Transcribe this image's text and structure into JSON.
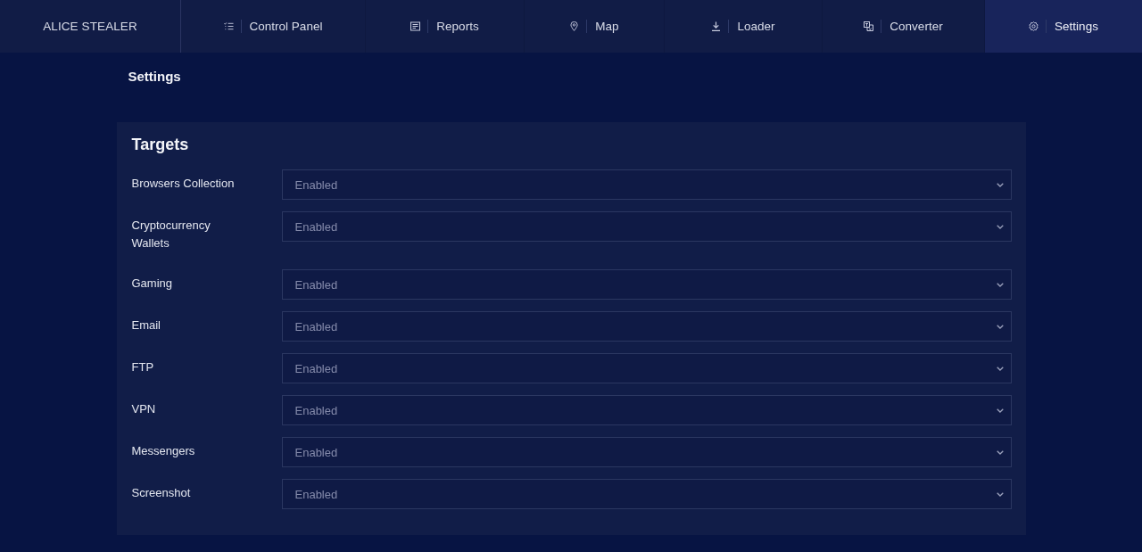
{
  "nav": {
    "brand": "ALICE STEALER",
    "tabs": [
      {
        "label": "Control Panel",
        "selected": false
      },
      {
        "label": "Reports",
        "selected": false
      },
      {
        "label": "Map",
        "selected": false
      },
      {
        "label": "Loader",
        "selected": false
      },
      {
        "label": "Converter",
        "selected": false
      },
      {
        "label": "Settings",
        "selected": true
      }
    ]
  },
  "page": {
    "title": "Settings"
  },
  "section": {
    "title": "Targets",
    "fields": [
      {
        "label": "Browsers Collection",
        "value": "Enabled"
      },
      {
        "label": "Cryptocurrency Wallets",
        "value": "Enabled"
      },
      {
        "label": "Gaming",
        "value": "Enabled"
      },
      {
        "label": "Email",
        "value": "Enabled"
      },
      {
        "label": "FTP",
        "value": "Enabled"
      },
      {
        "label": "VPN",
        "value": "Enabled"
      },
      {
        "label": "Messengers",
        "value": "Enabled"
      },
      {
        "label": "Screenshot",
        "value": "Enabled"
      }
    ]
  }
}
